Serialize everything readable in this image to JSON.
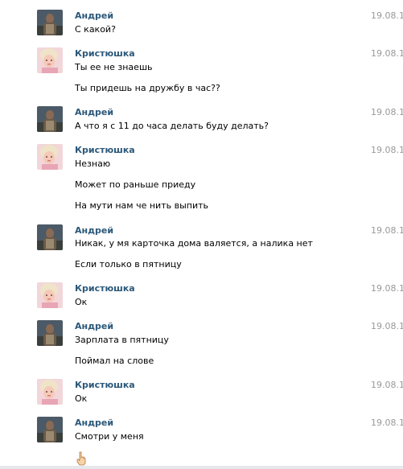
{
  "colors": {
    "author": "#2b587a",
    "time": "#999999",
    "text": "#000000"
  },
  "messages": [
    {
      "author": "Андрей",
      "time": "19.08.1",
      "lines": [
        "С какой?"
      ]
    },
    {
      "author": "Кристюшка",
      "time": "19.08.1",
      "lines": [
        "Ты ее не знаешь",
        "Ты придешь на дружбу в час??"
      ]
    },
    {
      "author": "Андрей",
      "time": "19.08.1",
      "lines": [
        "А что я с 11 до часа делать буду делать?"
      ]
    },
    {
      "author": "Кристюшка",
      "time": "19.08.1",
      "lines": [
        "Незнаю",
        "Может по раньше приеду",
        "На мути нам че нить выпить"
      ]
    },
    {
      "author": "Андрей",
      "time": "19.08.1",
      "lines": [
        "Никак, у мя карточка дома валяется, а налика нет",
        "Если только в пятницу"
      ]
    },
    {
      "author": "Кристюшка",
      "time": "19.08.1",
      "lines": [
        "Ок"
      ]
    },
    {
      "author": "Андрей",
      "time": "19.08.1",
      "lines": [
        "Зарплата в пятницу",
        "Поймал на слове"
      ]
    },
    {
      "author": "Кристюшка",
      "time": "19.08.1",
      "lines": [
        "Ок"
      ]
    },
    {
      "author": "Андрей",
      "time": "19.08.1",
      "lines": [
        "Смотри у меня"
      ]
    }
  ]
}
